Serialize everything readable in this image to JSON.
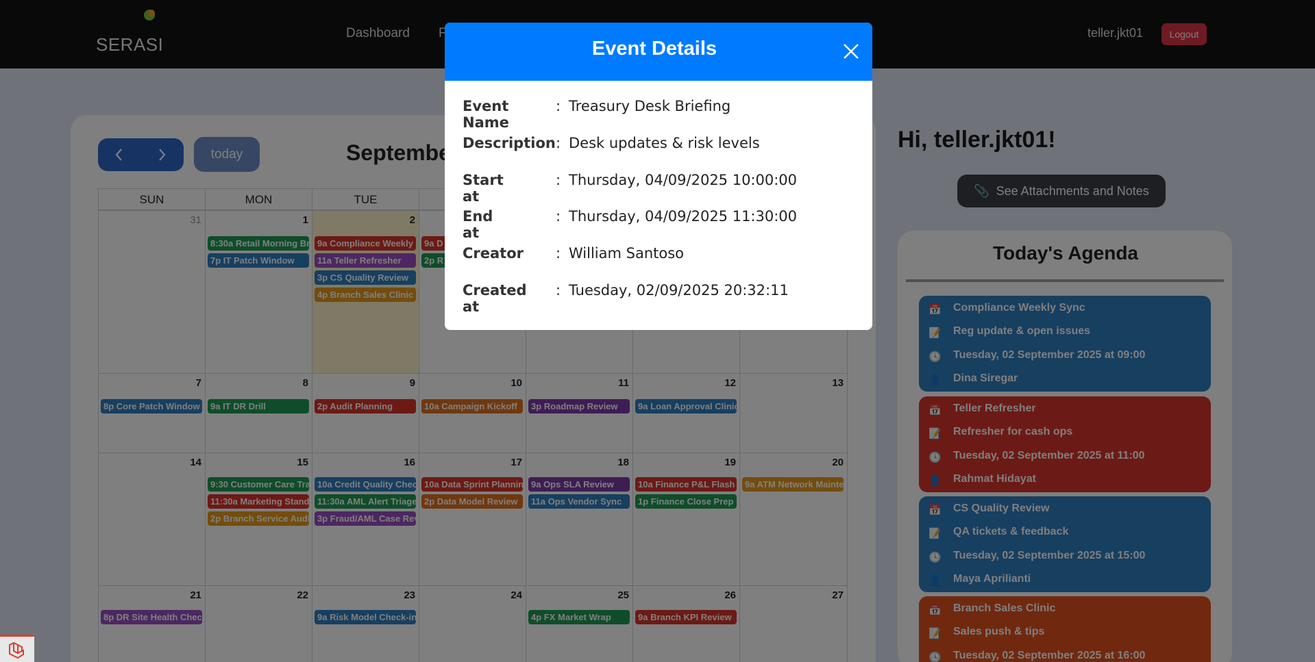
{
  "navbar": {
    "logo_text": "SERASI",
    "links": [
      "Dashboard",
      "F"
    ],
    "username": "teller.jkt01",
    "logout_label": "Logout"
  },
  "calendar": {
    "prev_icon": "chevron-left-icon",
    "next_icon": "chevron-right-icon",
    "today_label": "today",
    "title": "Septembe",
    "day_headers": [
      "SUN",
      "MON",
      "TUE"
    ],
    "weeks": [
      {
        "days": [
          "31",
          "1",
          "2",
          "",
          "",
          "",
          ""
        ]
      },
      {
        "days": [
          "7",
          "8",
          "9",
          "10",
          "11",
          "12",
          "13"
        ]
      },
      {
        "days": [
          "14",
          "15",
          "16",
          "17",
          "18",
          "19",
          "20"
        ]
      },
      {
        "days": [
          "21",
          "22",
          "23",
          "24",
          "25",
          "26",
          "27"
        ]
      }
    ],
    "events": [
      {
        "text": "8:30a Retail Morning Bri",
        "color": "#1f9b55"
      },
      {
        "text": "7p IT Patch Window",
        "color": "#2f7ec0"
      },
      {
        "text": "9a Compliance Weekly S",
        "color": "#d9342b"
      },
      {
        "text": "11a Teller Refresher",
        "color": "#9b4fc2"
      },
      {
        "text": "3p CS Quality Review",
        "color": "#2f7ec0"
      },
      {
        "text": "4p Branch Sales Clinic",
        "color": "#e79b1c"
      },
      {
        "text": "9a D",
        "color": "#d9342b"
      },
      {
        "text": "2p R",
        "color": "#1f9b55"
      },
      {
        "text": "8p Core Patch Window",
        "color": "#2f7ec0"
      },
      {
        "text": "9a IT DR Drill",
        "color": "#1f9b55"
      },
      {
        "text": "2p Audit Planning",
        "color": "#d9342b"
      },
      {
        "text": "10a Campaign Kickoff",
        "color": "#e0701f"
      },
      {
        "text": "3p Roadmap Review",
        "color": "#7d3aa8"
      },
      {
        "text": "9a Loan Approval Clinic",
        "color": "#2f7ec0"
      },
      {
        "text": "9:30 Customer Care Trai",
        "color": "#1f9b55"
      },
      {
        "text": "11:30a Marketing Standu",
        "color": "#d9342b"
      },
      {
        "text": "2p Branch Service Audit",
        "color": "#e79b1c"
      },
      {
        "text": "10a Credit Quality Check",
        "color": "#2f7ec0"
      },
      {
        "text": "11:30a AML Alert Triage",
        "color": "#1f9b55"
      },
      {
        "text": "3p Fraud/AML Case Revi",
        "color": "#9b4fc2"
      },
      {
        "text": "10a Data Sprint Planning",
        "color": "#d9342b"
      },
      {
        "text": "2p Data Model Review",
        "color": "#e0701f"
      },
      {
        "text": "9a Ops SLA Review",
        "color": "#7d3aa8"
      },
      {
        "text": "11a Ops Vendor Sync",
        "color": "#2f7ec0"
      },
      {
        "text": "10a Finance P&L Flash",
        "color": "#d9342b"
      },
      {
        "text": "1p Finance Close Prep",
        "color": "#1f9b55"
      },
      {
        "text": "9a ATM Network Mainte",
        "color": "#e79b1c"
      },
      {
        "text": "8p DR Site Health Check",
        "color": "#9b4fc2"
      },
      {
        "text": "9a Risk Model Check-in",
        "color": "#2f7ec0"
      },
      {
        "text": "4p FX Market Wrap",
        "color": "#1f9b55"
      },
      {
        "text": "9a Branch KPI Review",
        "color": "#d9342b"
      }
    ]
  },
  "sidebar": {
    "greeting": "Hi, teller.jkt01!",
    "attach_icon": "paperclip-icon",
    "attach_label": "See Attachments and Notes",
    "agenda_title": "Today's Agenda",
    "agenda": [
      {
        "title": "Compliance Weekly Sync",
        "desc": "Reg update & open issues",
        "time": "Tuesday, 02 September 2025 at 09:00",
        "person": "Dina Siregar",
        "color": "#2f7ec0"
      },
      {
        "title": "Teller Refresher",
        "desc": "Refresher for cash ops",
        "time": "Tuesday, 02 September 2025 at 11:00",
        "person": "Rahmat Hidayat",
        "color": "#d9342b"
      },
      {
        "title": "CS Quality Review",
        "desc": "QA tickets & feedback",
        "time": "Tuesday, 02 September 2025 at 15:00",
        "person": "Maya Aprilianti",
        "color": "#2f7ec0"
      },
      {
        "title": "Branch Sales Clinic",
        "desc": "Sales push & tips",
        "time": "Tuesday, 02 September 2025 at 16:00",
        "person": "",
        "color": "#e0521f"
      }
    ]
  },
  "modal": {
    "title": "Event Details",
    "close_icon": "close-icon",
    "rows": [
      {
        "label": "Event Name",
        "value": "Treasury Desk Briefing"
      },
      {
        "label": "Description",
        "value": "Desk updates & risk levels"
      },
      {
        "label": "Start at",
        "value": "Thursday, 04/09/2025 10:00:00"
      },
      {
        "label": "End at",
        "value": "Thursday, 04/09/2025 11:30:00"
      },
      {
        "label": "Creator",
        "value": "William Santoso"
      },
      {
        "label": "Created at",
        "value": "Tuesday, 02/09/2025 20:32:11"
      }
    ],
    "colon": ":"
  },
  "badge_icon": "laravel-icon"
}
